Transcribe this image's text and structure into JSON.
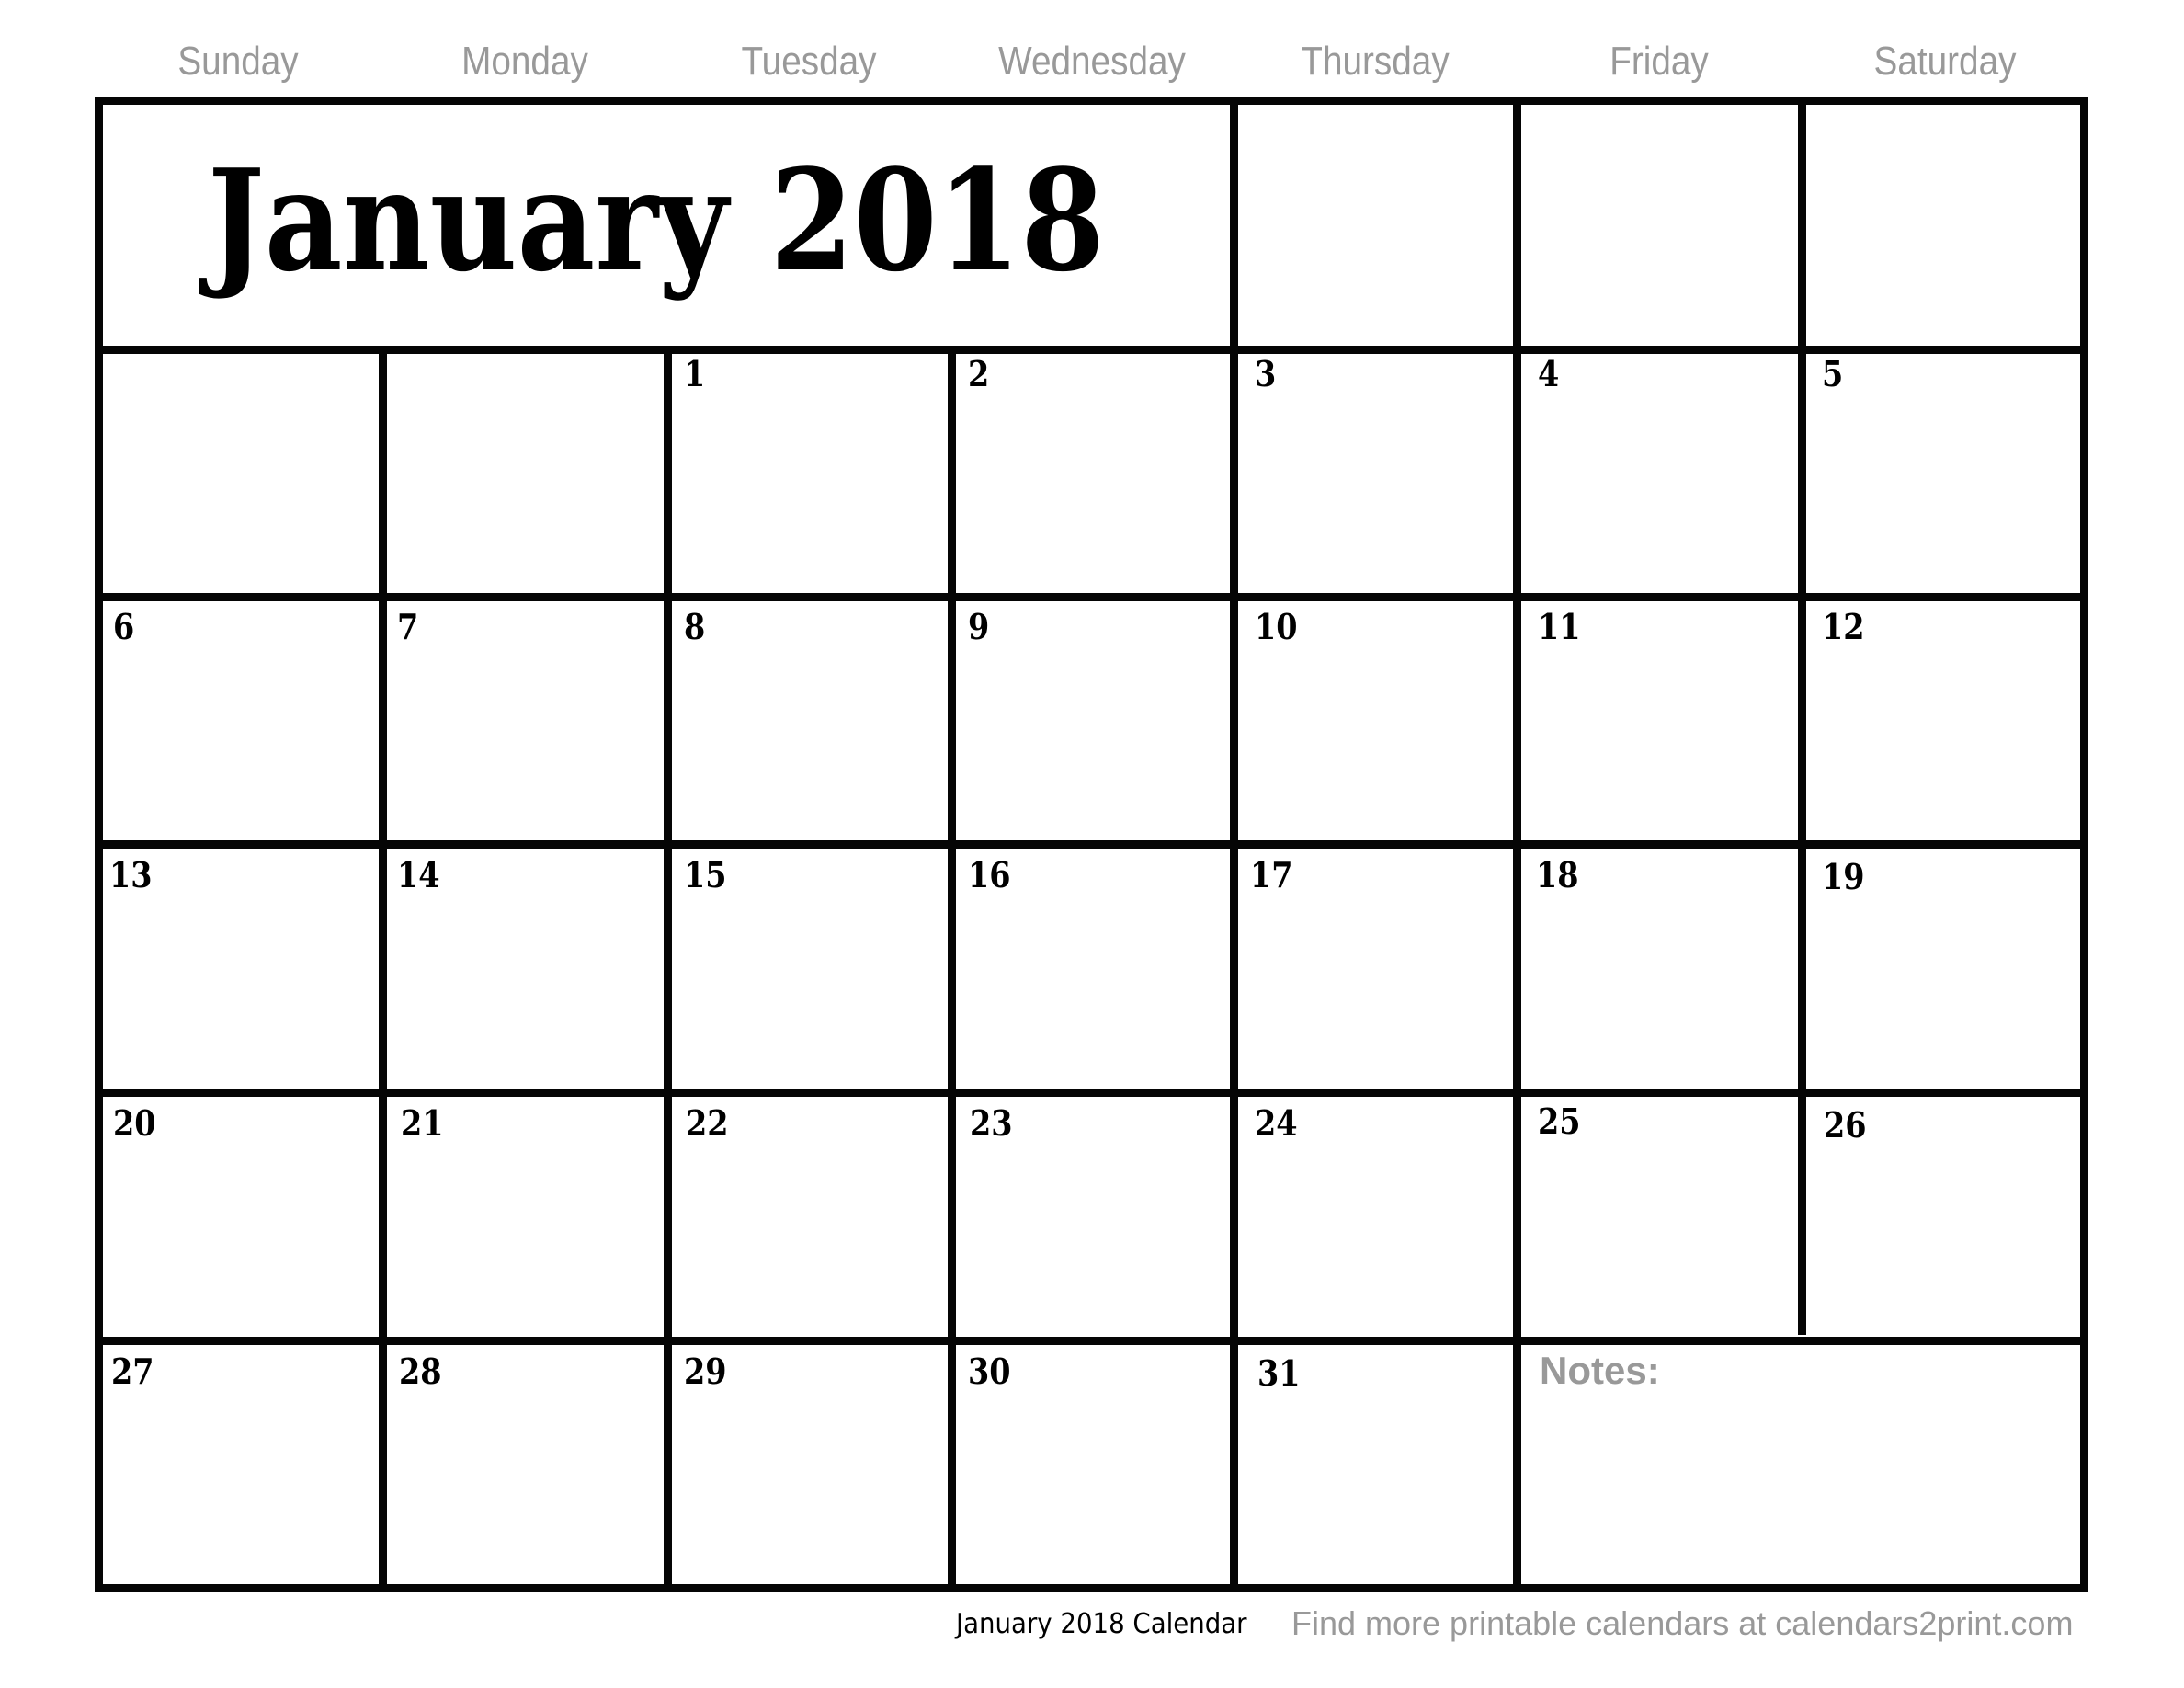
{
  "weekdays": [
    "Sunday",
    "Monday",
    "Tuesday",
    "Wednesday",
    "Thursday",
    "Friday",
    "Saturday"
  ],
  "title": "January 2018",
  "weeks": [
    [
      "",
      "",
      "1",
      "2",
      "3",
      "4",
      "5"
    ],
    [
      "6",
      "7",
      "8",
      "9",
      "10",
      "11",
      "12"
    ],
    [
      "13",
      "14",
      "15",
      "16",
      "17",
      "18",
      "19"
    ],
    [
      "20",
      "21",
      "22",
      "23",
      "24",
      "25",
      "26"
    ],
    [
      "27",
      "28",
      "29",
      "30",
      "31",
      "",
      ""
    ]
  ],
  "notes_label": "Notes:",
  "footer": {
    "calendar_label": "January 2018 Calendar",
    "promo_text": "Find more printable calendars at calendars2print.com"
  },
  "colors": {
    "grid_lines": "#050505",
    "weekday_text": "#999999",
    "notes_text": "#999999",
    "day_number_text": "#000000"
  }
}
